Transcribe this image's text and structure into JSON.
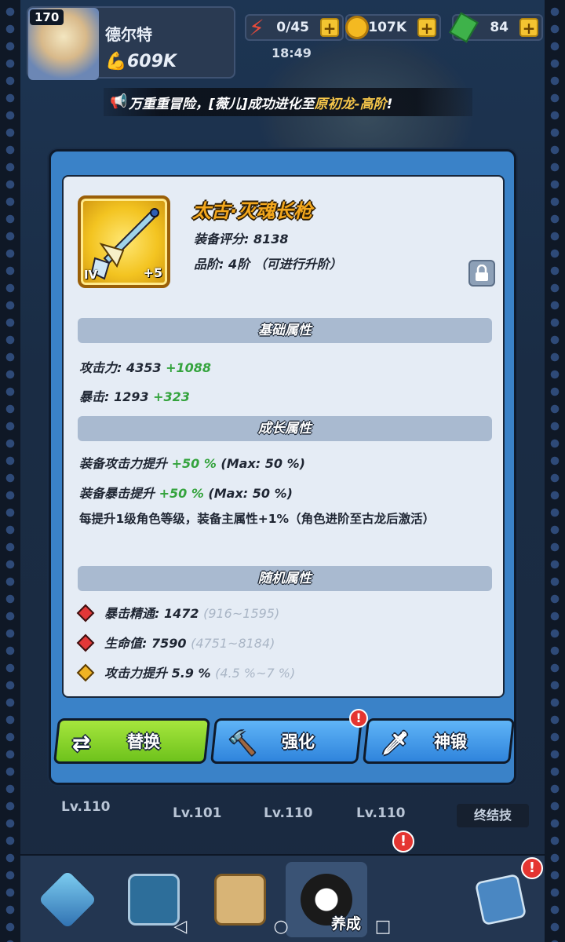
{
  "hud": {
    "player_level": "170",
    "player_name": "德尔特",
    "power_icon": "muscle-icon",
    "power": "609K",
    "energy": "0/45",
    "gold": "107K",
    "gems": "84",
    "clock": "18:49",
    "plus_label": "+"
  },
  "announcement": {
    "icon": "horn-icon",
    "prefix": "万重重冒险，[薇儿]成功进化至",
    "highlight": "原初龙-高阶",
    "suffix": "!"
  },
  "item": {
    "name": "太古·灭魂长枪",
    "score": "装备评分: 8138",
    "tier": "品阶: 4阶 （可进行升阶）",
    "tier_tag": "IV",
    "plus_tag": "+5",
    "icon": "spear-icon",
    "lock_icon": "lock-icon"
  },
  "sections": {
    "base": "基础属性",
    "growth": "成长属性",
    "random": "随机属性"
  },
  "base_stats": [
    {
      "label": "攻击力: 4353 ",
      "bonus": "+1088"
    },
    {
      "label": "暴击: 1293 ",
      "bonus": "+323"
    }
  ],
  "growth_stats": [
    {
      "label": "装备攻击力提升 ",
      "bonus": "+50 %",
      "max": " (Max: 50 %)"
    },
    {
      "label": "装备暴击提升 ",
      "bonus": "+50 %",
      "max": " (Max: 50 %)"
    }
  ],
  "growth_note": "每提升1级角色等级，装备主属性+1%（角色进阶至古龙后激活）",
  "random_stats": [
    {
      "label": "暴击精通: 1472 ",
      "range": "(916~1595)",
      "gem": "red"
    },
    {
      "label": "生命值: 7590 ",
      "range": "(4751~8184)",
      "gem": "red"
    },
    {
      "label": "攻击力提升 5.9 % ",
      "range": "(4.5 %~7 %)",
      "gem": "gold"
    }
  ],
  "buttons": {
    "replace": "替换",
    "enhance": "强化",
    "forge": "神锻",
    "alert": "!"
  },
  "background": {
    "levels": [
      "Lv.110",
      "Lv.101",
      "Lv.110",
      "Lv.110"
    ],
    "ultimate": "终结技",
    "active_tab": "养成",
    "alert": "!"
  },
  "colors": {
    "accent_green": "#6ec21c",
    "accent_blue": "#2f84dc",
    "bonus_green": "#34a33d",
    "item_name": "#f3a71d"
  }
}
